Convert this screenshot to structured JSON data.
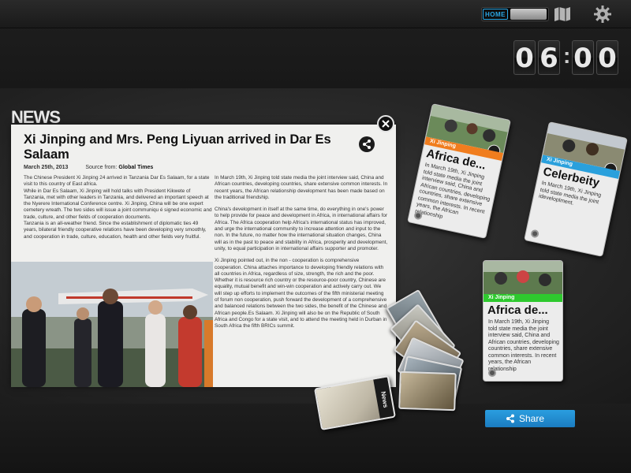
{
  "topbar": {
    "home_label": "HOME"
  },
  "clock": {
    "hour_tens": "0",
    "hour_ones": "6",
    "separator": ":",
    "minute_tens": "0",
    "minute_ones": "0"
  },
  "section_title": "NEWS",
  "article": {
    "headline": "Xi Jinping and Mrs. Peng Liyuan arrived in Dar Es Salaam",
    "date": "March 25th, 2013",
    "source_label": "Source from:",
    "source": "Global Times",
    "col1_paragraphs": [
      "The Chinese President Xi Jinping 24 arrived in Tanzania Dar Es Salaam, for a state visit to this country of East africa.",
      "While in Dar Es Salaam, Xi Jinping will hold talks with President Kikwete of Tanzania, met with other leaders in Tanzania, and delivered an important speech at the Nyerere International Conference centre. Xi Jinping, China will be one expert cemetery wreath. The two sides will issue a joint communiqu é signed economic and trade, culture, and other fields of cooperation documents.",
      "Tanzania is an all-weather friend. Since the establishment of diplomatic ties 49 years, bilateral friendly cooperative relations have been developing very smoothly, and cooperation in trade, culture, education, health and other fields very fruitful."
    ],
    "col2_paragraphs": [
      "In March 19th, Xi Jinping told state media the joint interview said, China and African countries, developing countries, share extensive common interests. In recent years, the African relationship development has been made based on the traditional friendship.",
      "China's development in itself at the same time, do everything in one's power to help provide for peace and development in Africa, in international affairs for Africa. The Africa cooperation help Africa's international status has improved, and urge the international community to increase attention and input to the non. In the future, no matter how the international situation changes, China will as in the past to peace and stability in Africa, prosperity and development, unity, to equal participation in international affairs supporter and promoter.",
      "Xi Jinping pointed out, in the non - cooperation is comprehensive cooperation. China attaches importance to developing friendly relations with all countries in Africa, regardless of size, strength, the rich and the poor. Whether it is resource rich country or the resource-poor country, Chinese are equality, mutual benefit and win-win cooperation and actively carry out. We will step up efforts to implement the outcomes of the fifth ministerial meeting of forum non cooperation, push forward the development of a comprehensive and balanced relations between the two sides, the benefit of the Chinese and African people.Es Salaam. Xi Jinping will also be on the Republic of South Africa and Congo for a state visit, and to attend the meeting held in Durban in South Africa the fifth BRICs summit."
    ]
  },
  "cards": [
    {
      "tag": "Xi Jinping",
      "tag_color": "#f07d1e",
      "title": "Africa de...",
      "body": "In March 19th, Xi Jinping told state media the joint interview said, China and African countries, developing countries, share extensive common interests. In recent years, the African relationship"
    },
    {
      "tag": "Xi Jinping",
      "tag_color": "#2aa0dc",
      "title": "Celerbeity",
      "body": "In March 19th, Xi Jinping told state media the joint ideveloplment."
    },
    {
      "tag": "Xi Jinping",
      "tag_color": "#2ec92e",
      "title": "Africa de...",
      "body": "In March 19th, Xi Jinping told state media the joint interview said, China and African countries, developing countries, share extensive common interests. In recent years, the African relationship"
    }
  ],
  "fan": {
    "front_label": "News"
  },
  "share_button": {
    "label": "Share"
  }
}
